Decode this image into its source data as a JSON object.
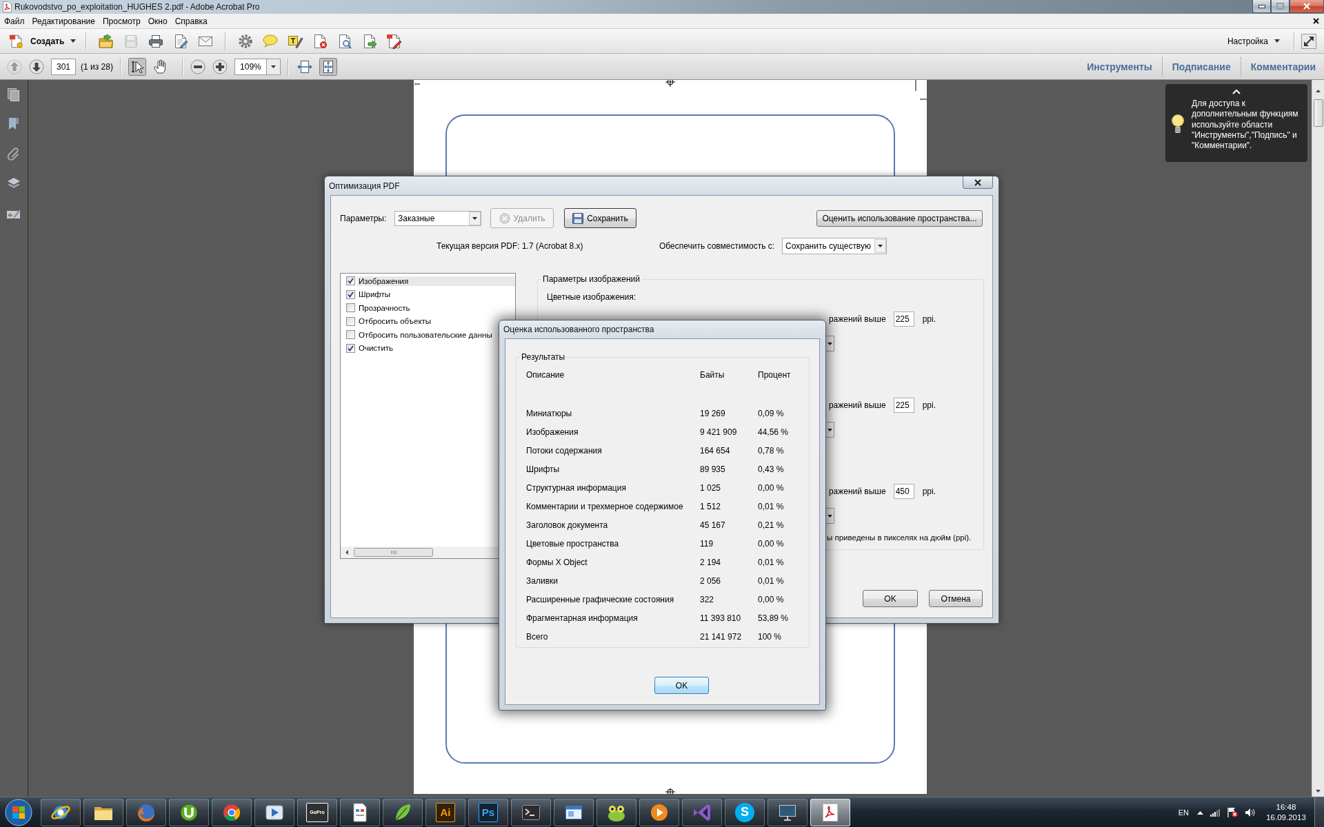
{
  "window": {
    "title": "Rukovodstvo_po_exploitation_HUGHES 2.pdf - Adobe Acrobat Pro"
  },
  "menu": [
    {
      "label": "Файл"
    },
    {
      "label": "Редактирование"
    },
    {
      "label": "Просмотр"
    },
    {
      "label": "Окно"
    },
    {
      "label": "Справка"
    }
  ],
  "toolbar": {
    "create_label": "Создать",
    "tool_groups": [
      {
        "tools": [
          {
            "kind": "open",
            "disabled": false
          },
          {
            "kind": "save",
            "disabled": true
          },
          {
            "kind": "print",
            "disabled": false
          },
          {
            "kind": "edit",
            "disabled": false
          },
          {
            "kind": "mail",
            "disabled": false
          }
        ]
      },
      {
        "tools": [
          {
            "kind": "gear",
            "disabled": false
          },
          {
            "kind": "comment",
            "disabled": false
          },
          {
            "kind": "highlight",
            "disabled": false
          },
          {
            "kind": "doc-delete",
            "disabled": false
          },
          {
            "kind": "doc-search",
            "disabled": false
          },
          {
            "kind": "doc-export",
            "disabled": false
          },
          {
            "kind": "doc-sign",
            "disabled": false
          }
        ]
      }
    ],
    "customize_label": "Настройка"
  },
  "nav_toolbar": {
    "page_buttons": [
      {
        "kind": "prev",
        "disabled": true
      },
      {
        "kind": "next",
        "disabled": false
      }
    ],
    "page_field": {
      "value": "301"
    },
    "page_count": "(1 из 28)",
    "tools": [
      {
        "kind": "select",
        "selected": true
      },
      {
        "kind": "hand",
        "selected": false
      }
    ],
    "zoom_field": {
      "value": "109%"
    },
    "view_modes": [
      {
        "kind": "fit-width",
        "selected": false
      },
      {
        "kind": "fit-page",
        "selected": true
      }
    ],
    "panes": [
      {
        "label": "Инструменты",
        "selected": false
      },
      {
        "label": "Подписание",
        "selected": false
      },
      {
        "label": "Комментарии",
        "selected": false
      }
    ]
  },
  "tooltip": {
    "text": "Для доступа к дополнительным функциям используйте области \"Инструменты\",\"Подпись\" и \"Комментарии\"."
  },
  "optimize_dialog": {
    "title": "Оптимизация PDF",
    "preset_label": "Параметры:",
    "preset_combo": {
      "value": "Заказные"
    },
    "actions": [
      {
        "kind": "delete",
        "label": "Удалить",
        "disabled": true
      },
      {
        "kind": "save",
        "label": "Сохранить",
        "disabled": false
      }
    ],
    "audit_button": {
      "label": "Оценить использование пространства..."
    },
    "version_text": "Текущая версия PDF: 1.7 (Acrobat 8.x)",
    "compat_label": "Обеспечить совместимость с:",
    "compat_combo": {
      "value": "Сохранить существую"
    },
    "panels": [
      {
        "label": "Изображения",
        "checked": true,
        "selected": true
      },
      {
        "label": "Шрифты",
        "checked": true,
        "selected": false
      },
      {
        "label": "Прозрачность",
        "checked": false,
        "selected": false
      },
      {
        "label": "Отбросить объекты",
        "checked": false,
        "selected": false
      },
      {
        "label": "Отбросить пользовательские данны",
        "checked": false,
        "selected": false
      },
      {
        "label": "Очистить",
        "checked": true,
        "selected": false
      }
    ],
    "image_settings": {
      "title": "Параметры изображений",
      "color_images_label": "Цветные изображения:",
      "rows": [
        {
          "text": "ражений выше",
          "ppi": "225",
          "unit": "ppi."
        },
        {
          "text": "ражений выше",
          "ppi": "225",
          "unit": "ppi."
        },
        {
          "text": "ражений выше",
          "ppi": "450",
          "unit": "ppi."
        }
      ],
      "note": "ы приведены в пикселях на дюйм (ppi)."
    },
    "buttons": [
      {
        "kind": "ok",
        "label": "OK"
      },
      {
        "kind": "cancel",
        "label": "Отмена"
      }
    ]
  },
  "results_dialog": {
    "title": "Оценка использованного пространства",
    "group_title": "Результаты",
    "columns": [
      {
        "label": "Описание"
      },
      {
        "label": "Байты"
      },
      {
        "label": "Процент"
      }
    ],
    "rows": [
      {
        "description": "Миниатюры",
        "bytes": "19 269",
        "percent": "0,09 %"
      },
      {
        "description": "Изображения",
        "bytes": "9 421 909",
        "percent": "44,56 %"
      },
      {
        "description": "Потоки содержания",
        "bytes": "164 654",
        "percent": "0,78 %"
      },
      {
        "description": "Шрифты",
        "bytes": "89 935",
        "percent": "0,43 %"
      },
      {
        "description": "Структурная информация",
        "bytes": "1 025",
        "percent": "0,00 %"
      },
      {
        "description": "Комментарии и трехмерное содержимое",
        "bytes": "1 512",
        "percent": "0,01 %"
      },
      {
        "description": "Заголовок документа",
        "bytes": "45 167",
        "percent": "0,21 %"
      },
      {
        "description": "Цветовые пространства",
        "bytes": "119",
        "percent": "0,00 %"
      },
      {
        "description": "Формы X Object",
        "bytes": "2 194",
        "percent": "0,01 %"
      },
      {
        "description": "Заливки",
        "bytes": "2 056",
        "percent": "0,01 %"
      },
      {
        "description": "Расширенные графические состояния",
        "bytes": "322",
        "percent": "0,00 %"
      },
      {
        "description": "Фрагментарная информация",
        "bytes": "11 393 810",
        "percent": "53,89 %"
      },
      {
        "description": "Всего",
        "bytes": "21 141 972",
        "percent": "100 %"
      }
    ],
    "ok_button": {
      "label": "OK"
    }
  },
  "taskbar": {
    "apps": [
      {
        "kind": "globe",
        "selected": false
      },
      {
        "kind": "folder",
        "selected": false
      },
      {
        "kind": "fox",
        "selected": false
      },
      {
        "kind": "u-circle",
        "selected": false
      },
      {
        "kind": "wheel",
        "selected": false
      },
      {
        "kind": "play-window",
        "selected": false
      },
      {
        "kind": "letter-tile",
        "label": "GoPro",
        "color": "#ffffff",
        "selected": false
      },
      {
        "kind": "document",
        "selected": false
      },
      {
        "kind": "leaf",
        "selected": false
      },
      {
        "kind": "letter-tile",
        "label": "Ai",
        "color": "#ff9a00",
        "selected": false
      },
      {
        "kind": "letter-tile",
        "label": "Ps",
        "color": "#31a8ff",
        "selected": false
      },
      {
        "kind": "terminal",
        "selected": false
      },
      {
        "kind": "window",
        "selected": false
      },
      {
        "kind": "frog",
        "selected": false
      },
      {
        "kind": "play-circle",
        "selected": false
      },
      {
        "kind": "bow",
        "selected": false
      },
      {
        "kind": "letter-circle",
        "label": "S",
        "color": "#00aff0",
        "selected": false
      },
      {
        "kind": "monitor",
        "selected": false
      },
      {
        "kind": "pdf",
        "selected": true
      }
    ],
    "language": "EN",
    "time": "16:48",
    "date": "16.09.2013"
  }
}
